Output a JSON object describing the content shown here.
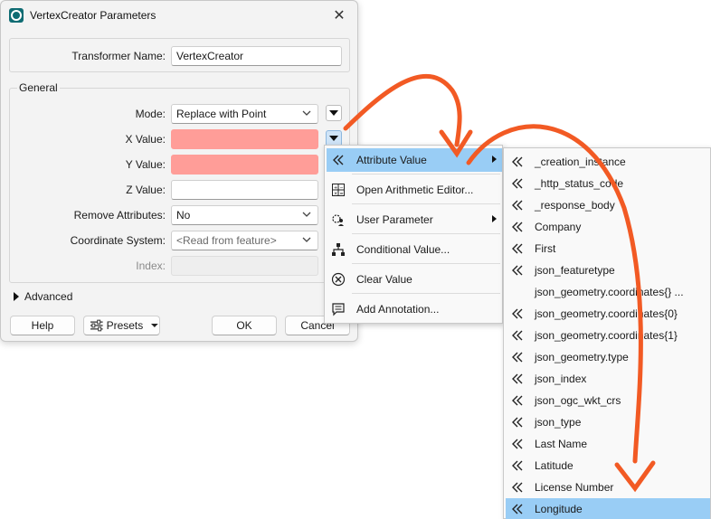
{
  "window": {
    "title": "VertexCreator Parameters",
    "close_glyph": "✕"
  },
  "transformer": {
    "label": "Transformer Name:",
    "value": "VertexCreator"
  },
  "general": {
    "title": "General",
    "mode": {
      "label": "Mode:",
      "value": "Replace with Point"
    },
    "x_value": {
      "label": "X Value:",
      "value": "",
      "color": "#ff9d98"
    },
    "y_value": {
      "label": "Y Value:",
      "value": "",
      "color": "#ff9d98"
    },
    "z_value": {
      "label": "Z Value:",
      "value": ""
    },
    "remove_attributes": {
      "label": "Remove Attributes:",
      "value": "No"
    },
    "coordinate_system": {
      "label": "Coordinate System:",
      "value": "<Read from feature>"
    },
    "index": {
      "label": "Index:",
      "value": ""
    }
  },
  "advanced": {
    "label": "Advanced"
  },
  "footer": {
    "help": "Help",
    "presets": "Presets",
    "ok": "OK",
    "cancel": "Cancel"
  },
  "context_menu": {
    "items": [
      {
        "label": "Attribute Value",
        "icon": "attribute-icon",
        "has_submenu": true,
        "highlighted": true
      },
      {
        "label": "Open Arithmetic Editor...",
        "icon": "calculator-icon",
        "has_submenu": false
      },
      {
        "label": "User Parameter",
        "icon": "user-parameter-icon",
        "has_submenu": true
      },
      {
        "label": "Conditional Value...",
        "icon": "conditional-icon",
        "has_submenu": false
      },
      {
        "label": "Clear Value",
        "icon": "clear-icon",
        "has_submenu": false
      },
      {
        "label": "Add Annotation...",
        "icon": "annotation-icon",
        "has_submenu": false
      }
    ]
  },
  "attribute_submenu": {
    "items": [
      {
        "label": "_creation_instance",
        "icon": "attribute-icon"
      },
      {
        "label": "_http_status_code",
        "icon": "attribute-icon"
      },
      {
        "label": "_response_body",
        "icon": "attribute-icon"
      },
      {
        "label": "Company",
        "icon": "attribute-icon"
      },
      {
        "label": "First",
        "icon": "attribute-icon"
      },
      {
        "label": "json_featuretype",
        "icon": "attribute-icon"
      },
      {
        "label": "json_geometry.coordinates{} ...",
        "icon": ""
      },
      {
        "label": "json_geometry.coordinates{0}",
        "icon": "attribute-icon"
      },
      {
        "label": "json_geometry.coordinates{1}",
        "icon": "attribute-icon"
      },
      {
        "label": "json_geometry.type",
        "icon": "attribute-icon"
      },
      {
        "label": "json_index",
        "icon": "attribute-icon"
      },
      {
        "label": "json_ogc_wkt_crs",
        "icon": "attribute-icon"
      },
      {
        "label": "json_type",
        "icon": "attribute-icon"
      },
      {
        "label": "Last Name",
        "icon": "attribute-icon"
      },
      {
        "label": "Latitude",
        "icon": "attribute-icon"
      },
      {
        "label": "License Number",
        "icon": "attribute-icon"
      },
      {
        "label": "Longitude",
        "icon": "attribute-icon",
        "highlighted": true
      }
    ]
  },
  "annotation_arrows": {
    "color": "#f25a24"
  }
}
